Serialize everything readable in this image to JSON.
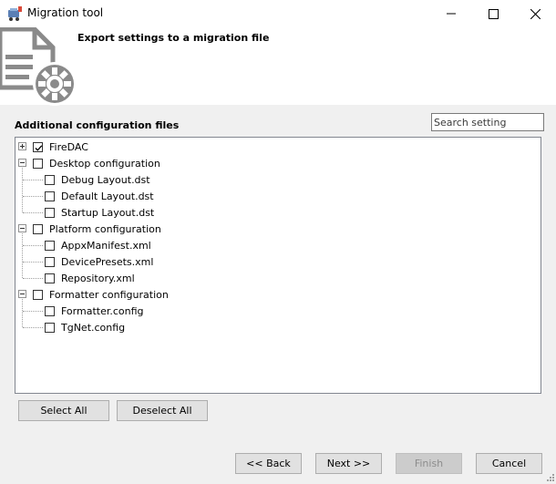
{
  "window": {
    "title": "Migration tool",
    "controls": [
      "minimize-icon",
      "maximize-icon",
      "close-icon"
    ]
  },
  "header": {
    "title": "Export settings to a migration file",
    "icon": "document-gear-icon"
  },
  "section": {
    "label": "Additional configuration files"
  },
  "search": {
    "placeholder": "Search setting",
    "value": ""
  },
  "tree": {
    "nodes": [
      {
        "label": "FireDAC",
        "checked": true,
        "expander": "plus",
        "children": []
      },
      {
        "label": "Desktop configuration",
        "checked": false,
        "expander": "minus",
        "children": [
          {
            "label": "Debug Layout.dst",
            "checked": false
          },
          {
            "label": "Default Layout.dst",
            "checked": false
          },
          {
            "label": "Startup Layout.dst",
            "checked": false
          }
        ]
      },
      {
        "label": "Platform configuration",
        "checked": false,
        "expander": "minus",
        "children": [
          {
            "label": "AppxManifest.xml",
            "checked": false
          },
          {
            "label": "DevicePresets.xml",
            "checked": false
          },
          {
            "label": "Repository.xml",
            "checked": false
          }
        ]
      },
      {
        "label": "Formatter configuration",
        "checked": false,
        "expander": "minus",
        "children": [
          {
            "label": "Formatter.config",
            "checked": false
          },
          {
            "label": "TgNet.config",
            "checked": false
          }
        ]
      }
    ]
  },
  "selection_buttons": {
    "select_all": "Select All",
    "deselect_all": "Deselect All"
  },
  "wizard_buttons": {
    "back": "<< Back",
    "next": "Next >>",
    "finish": "Finish",
    "finish_enabled": false,
    "cancel": "Cancel"
  },
  "colors": {
    "header_bg": "#ffffff",
    "body_bg": "#f0f0f0",
    "icon_gray": "#8a8a8a",
    "button_bg": "#e1e1e1"
  }
}
